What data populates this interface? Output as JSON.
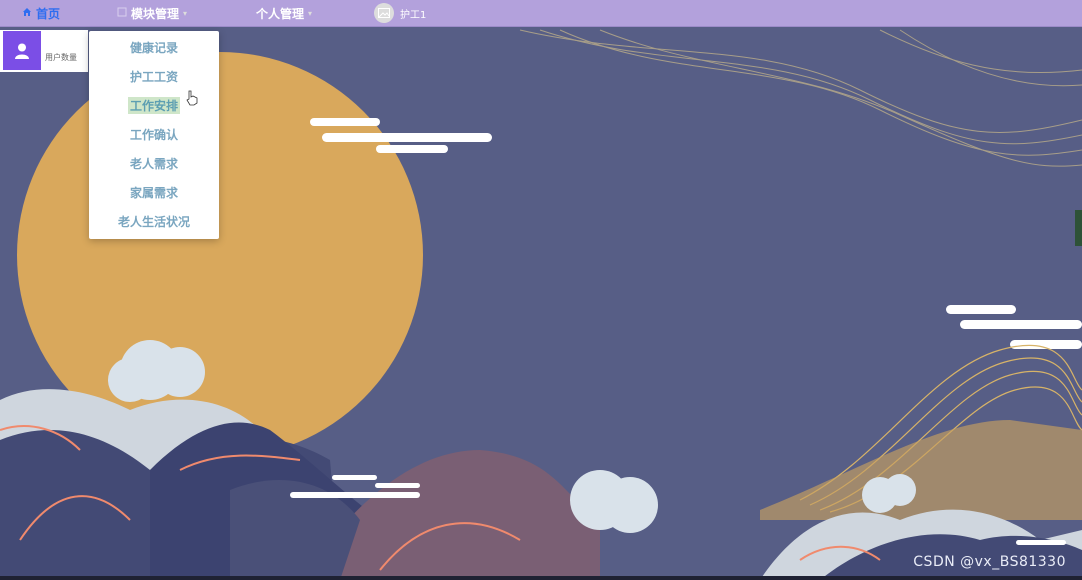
{
  "nav": {
    "home_label": "首页",
    "module_label": "模块管理",
    "personal_label": "个人管理",
    "user_label": "护工1"
  },
  "dropdown": {
    "items": [
      {
        "label": "健康记录"
      },
      {
        "label": "护工工资"
      },
      {
        "label": "工作安排"
      },
      {
        "label": "工作确认"
      },
      {
        "label": "老人需求"
      },
      {
        "label": "家属需求"
      },
      {
        "label": "老人生活状况"
      }
    ],
    "highlighted_index": 2
  },
  "stat_card": {
    "label": "用户数量",
    "icon": "user-icon",
    "accent": "#7b4ee6"
  },
  "watermark": "CSDN @vx_BS81330",
  "colors": {
    "topbar": "#b3a1dc",
    "home_accent": "#2f6df0",
    "background": "#575e86",
    "moon": "#d9a85c"
  }
}
